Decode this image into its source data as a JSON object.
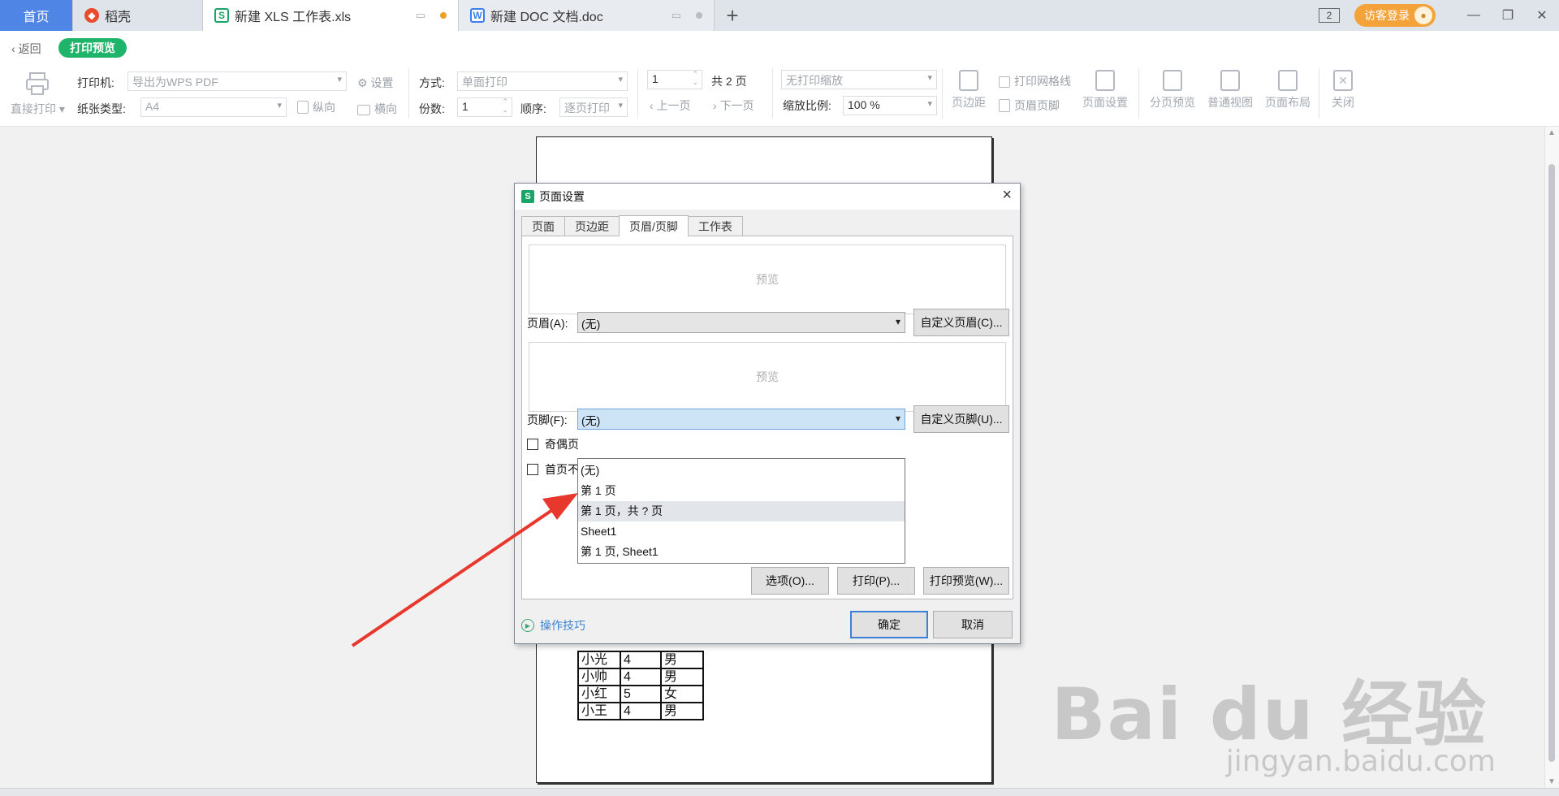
{
  "tabs": {
    "home": "首页",
    "daoke": "稻壳",
    "xls": "新建 XLS 工作表.xls",
    "doc": "新建 DOC 文档.doc",
    "add": "+",
    "window_count": "2",
    "login": "访客登录"
  },
  "toolbar": {
    "back": "返回",
    "print_preview": "打印预览",
    "direct_print": "直接打印",
    "printer_label": "打印机:",
    "printer_value": "导出为WPS PDF",
    "settings": "设置",
    "paper_label": "纸张类型:",
    "paper_value": "A4",
    "portrait": "纵向",
    "landscape": "横向",
    "mode_label": "方式:",
    "mode_value": "单面打印",
    "copies_label": "份数:",
    "copies_value": "1",
    "order_label": "顺序:",
    "order_value": "逐页打印",
    "page_value": "1",
    "total_pages": "共 2 页",
    "prev_page": "上一页",
    "next_page": "下一页",
    "scale_mode": "无打印缩放",
    "scale_label": "缩放比例:",
    "scale_value": "100 %",
    "margins": "页边距",
    "gridlines": "打印网格线",
    "header_footer": "页眉页脚",
    "page_setup": "页面设置",
    "page_break_preview": "分页预览",
    "normal_view": "普通视图",
    "page_layout": "页面布局",
    "close": "关闭"
  },
  "sheet_rows": [
    [
      "小光",
      "4",
      "男"
    ],
    [
      "小帅",
      "4",
      "男"
    ],
    [
      "小红",
      "5",
      "女"
    ],
    [
      "小王",
      "4",
      "男"
    ]
  ],
  "dialog": {
    "title": "页面设置",
    "logo": "S",
    "close": "×",
    "tabs": [
      "页面",
      "页边距",
      "页眉/页脚",
      "工作表"
    ],
    "preview": "预览",
    "header_label": "页眉(A):",
    "header_value": "(无)",
    "custom_header": "自定义页眉(C)...",
    "footer_label": "页脚(F):",
    "footer_value": "(无)",
    "custom_footer": "自定义页脚(U)...",
    "odd_even": "奇偶页",
    "first_page": "首页不",
    "options": "选项(O)...",
    "print": "打印(P)...",
    "print_preview": "打印预览(W)...",
    "tips": "操作技巧",
    "ok": "确定",
    "cancel": "取消",
    "footer_options": [
      "(无)",
      "第 1 页",
      "第 1 页，共 ? 页",
      "Sheet1",
      "第 1 页, Sheet1"
    ]
  },
  "watermark": {
    "main": "Bai du 经验",
    "sub": "jingyan.baidu.com"
  },
  "colors": {
    "accent_green": "#1eb56a",
    "home_tab": "#4f86e6",
    "login": "#f3a33a",
    "annotation_arrow": "#e8382e"
  }
}
